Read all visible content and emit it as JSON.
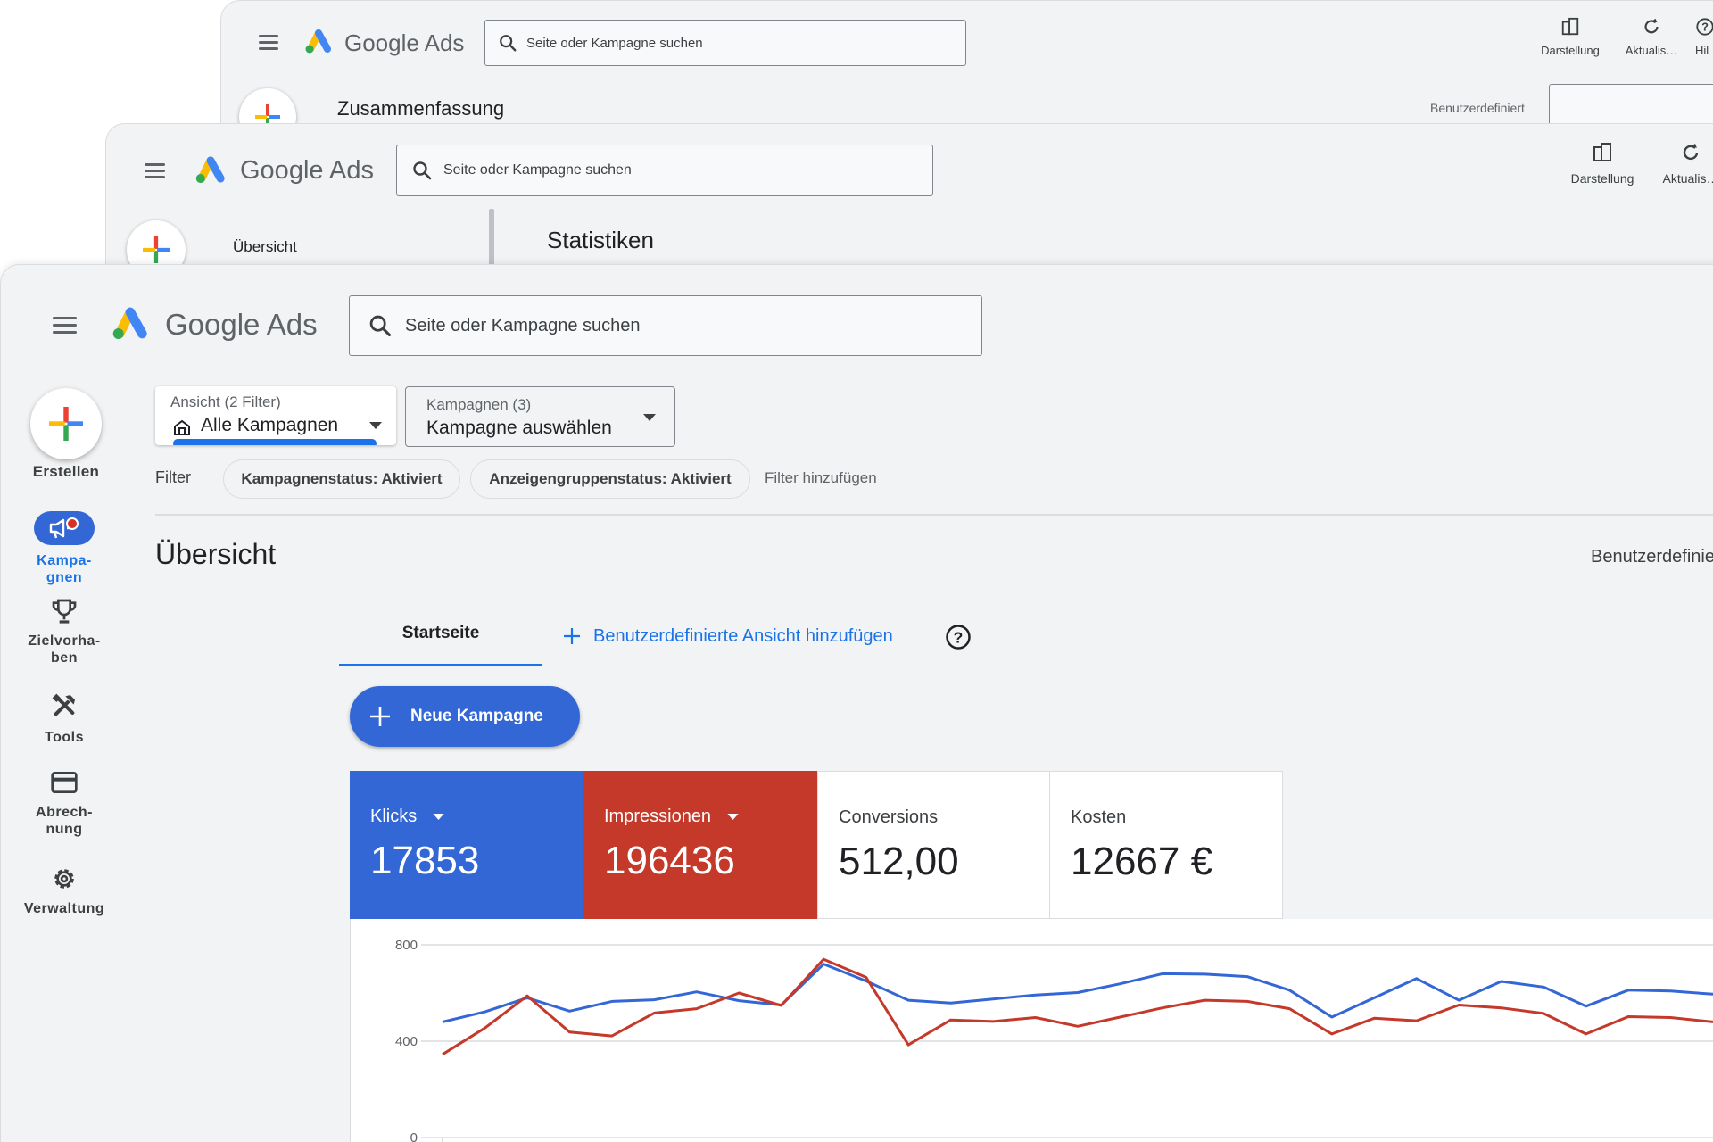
{
  "app": {
    "logo_text": "Google Ads"
  },
  "back_window": {
    "search_placeholder": "Seite oder Kampagne suchen",
    "tools": [
      "Darstellung",
      "Aktualis…",
      "Hil"
    ],
    "page_title": "Zusammenfassung",
    "date_label": "Benutzerdefiniert"
  },
  "mid_window": {
    "search_placeholder": "Seite oder Kampagne suchen",
    "tools": [
      "Darstellung",
      "Aktualis…"
    ],
    "nav_item": "Übersicht",
    "section_title": "Statistiken"
  },
  "front_window": {
    "search_placeholder": "Seite oder Kampagne suchen",
    "create_label": "Erstellen",
    "nav": [
      {
        "label": "Kampa-\ngnen",
        "icon": "campaigns-icon",
        "active": true
      },
      {
        "label": "Zielvorha-\nben",
        "icon": "trophy-icon",
        "active": false
      },
      {
        "label": "Tools",
        "icon": "tools-icon",
        "active": false
      },
      {
        "label": "Abrech-\nnung",
        "icon": "credit-card-icon",
        "active": false
      },
      {
        "label": "Verwaltung",
        "icon": "gear-icon",
        "active": false
      }
    ],
    "view_dropdown": {
      "label": "Ansicht (2 Filter)",
      "value": "Alle Kampagnen"
    },
    "campaign_dropdown": {
      "label": "Kampagnen (3)",
      "value": "Kampagne auswählen"
    },
    "filter_label": "Filter",
    "filter_chips": [
      "Kampagnenstatus: Aktiviert",
      "Anzeigengruppenstatus: Aktiviert"
    ],
    "add_filter": "Filter hinzufügen",
    "page_title": "Übersicht",
    "date_label": "Benutzerdefinie",
    "tabs": {
      "home": "Startseite",
      "add_view": "Benutzerdefinierte Ansicht hinzufügen"
    },
    "new_campaign_button": "Neue Kampagne",
    "metrics": [
      {
        "label": "Klicks",
        "value": "17853",
        "color": "#3367d6",
        "dropdown": true
      },
      {
        "label": "Impressionen",
        "value": "196436",
        "color": "#c5392b",
        "dropdown": true
      },
      {
        "label": "Conversions",
        "value": "512,00",
        "color": "#ffffff",
        "dropdown": false
      },
      {
        "label": "Kosten",
        "value": "12667 €",
        "color": "#ffffff",
        "dropdown": false
      }
    ]
  },
  "colors": {
    "blue": "#3367d6",
    "red": "#c5392b",
    "accent": "#1a73e8",
    "background": "#f1f3f4"
  },
  "chart_data": {
    "type": "line",
    "ylim": [
      0,
      800
    ],
    "y_ticks": [
      "800",
      "400",
      "0"
    ],
    "grid": true,
    "series": [
      {
        "color": "#3367d6",
        "values": [
          480,
          522,
          580,
          525,
          565,
          572,
          605,
          568,
          550,
          720,
          650,
          570,
          558,
          575,
          592,
          602,
          638,
          680,
          678,
          668,
          612,
          500,
          580,
          660,
          570,
          648,
          625,
          545,
          612,
          608,
          595
        ]
      },
      {
        "color": "#c5392b",
        "values": [
          345,
          455,
          588,
          438,
          422,
          517,
          535,
          600,
          548,
          740,
          665,
          385,
          488,
          482,
          498,
          462,
          500,
          538,
          570,
          565,
          535,
          430,
          495,
          485,
          550,
          538,
          515,
          430,
          502,
          498,
          480
        ]
      }
    ]
  }
}
